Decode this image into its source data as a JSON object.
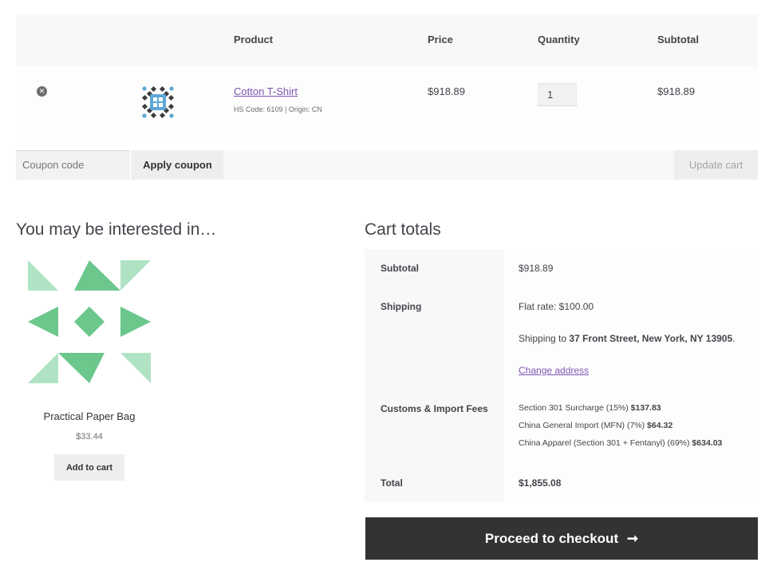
{
  "cart_table": {
    "headers": {
      "product": "Product",
      "price": "Price",
      "quantity": "Quantity",
      "subtotal": "Subtotal"
    },
    "item": {
      "remove_icon": "close-circle-icon",
      "name": "Cotton T-Shirt",
      "meta": "HS Code: 6109 | Origin: CN",
      "price": "$918.89",
      "quantity": "1",
      "subtotal": "$918.89"
    }
  },
  "actions": {
    "coupon_placeholder": "Coupon code",
    "apply_label": "Apply coupon",
    "update_label": "Update cart"
  },
  "cross_sells": {
    "title": "You may be interested in…",
    "product": {
      "name": "Practical Paper Bag",
      "price": "$33.44",
      "button": "Add to cart",
      "colors": [
        "#6cc78d",
        "#b0e3c4"
      ]
    }
  },
  "cart_totals": {
    "title": "Cart totals",
    "subtotal_label": "Subtotal",
    "subtotal_value": "$918.89",
    "shipping_label": "Shipping",
    "shipping_rate": "Flat rate: $100.00",
    "shipping_to_prefix": "Shipping to ",
    "shipping_address": "37 Front Street, New York, NY 13905",
    "shipping_to_suffix": ".",
    "change_address": "Change address",
    "fees_label": "Customs & Import Fees",
    "fees": [
      {
        "name": "Section 301 Surcharge (15%)",
        "amount": "$137.83"
      },
      {
        "name": "China General Import (MFN) (7%)",
        "amount": "$64.32"
      },
      {
        "name": "China Apparel (Section 301 + Fentanyl) (69%)",
        "amount": "$634.03"
      }
    ],
    "total_label": "Total",
    "total_value": "$1,855.08"
  },
  "checkout": {
    "label": "Proceed to checkout",
    "arrow": "➞"
  },
  "colors": {
    "link": "#7f54b3",
    "dark_button": "#333333"
  }
}
